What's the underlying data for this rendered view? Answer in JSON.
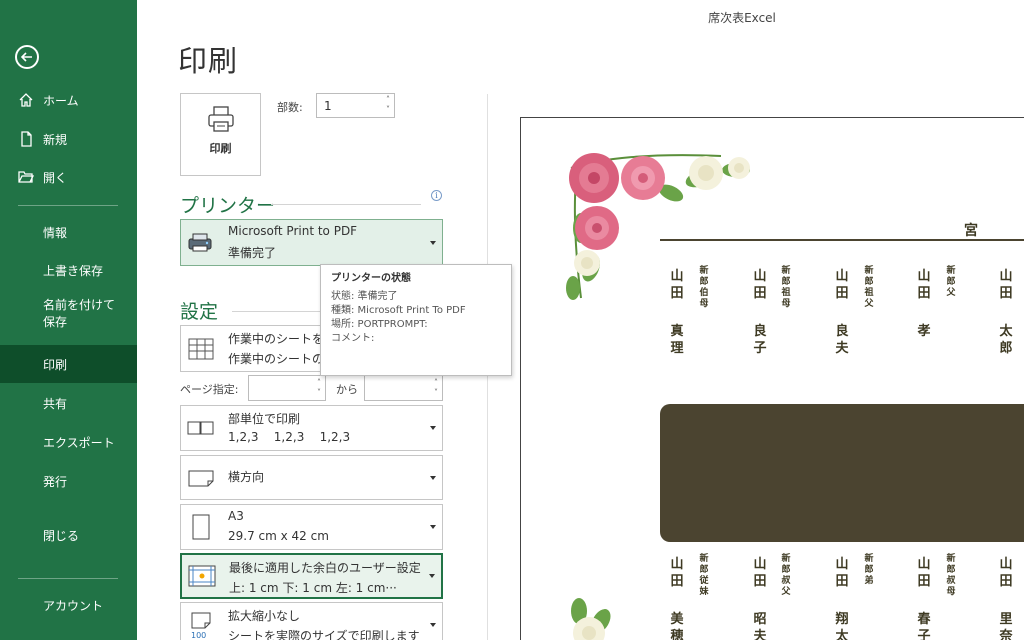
{
  "app": {
    "window_title": "席次表Excel"
  },
  "sidebar": {
    "items": [
      {
        "label": "ホーム"
      },
      {
        "label": "新規"
      },
      {
        "label": "開く"
      },
      {
        "label": "情報"
      },
      {
        "label": "上書き保存"
      },
      {
        "label": "名前を付けて保存"
      },
      {
        "label": "印刷"
      },
      {
        "label": "共有"
      },
      {
        "label": "エクスポート"
      },
      {
        "label": "発行"
      },
      {
        "label": "閉じる"
      },
      {
        "label": "アカウント"
      }
    ],
    "active": "印刷"
  },
  "page": {
    "title": "印刷"
  },
  "print": {
    "button_label": "印刷",
    "copies_label": "部数:",
    "copies_value": "1"
  },
  "printer": {
    "section_title": "プリンター",
    "name": "Microsoft Print to PDF",
    "status": "準備完了"
  },
  "tooltip": {
    "title": "プリンターの状態",
    "lines": [
      "状態: 準備完了",
      "種類: Microsoft Print To PDF",
      "場所: PORTPROMPT:",
      "コメント:"
    ]
  },
  "settings": {
    "section_title": "設定",
    "scope": {
      "line1": "作業中のシートを",
      "line2": "作業中のシートの"
    },
    "pages_label": "ページ指定:",
    "to_label": "から",
    "collate": {
      "line1": "部単位で印刷",
      "line2": "1,2,3    1,2,3    1,2,3"
    },
    "orientation": {
      "line1": "横方向"
    },
    "paper": {
      "line1": "A3",
      "line2": "29.7 cm x 42 cm"
    },
    "margins": {
      "line1": "最後に適用した余白のユーザー設定",
      "line2": "上: 1 cm 下: 1 cm 左: 1 cm···"
    },
    "scaling": {
      "line1": "拡大縮小なし",
      "line2": "シートを実際のサイズで印刷します",
      "icon_text": "100"
    }
  },
  "preview": {
    "header_char": "宮",
    "top_guests": [
      {
        "role": "新郎伯母",
        "surname": "山田",
        "given": "真理"
      },
      {
        "role": "新郎祖母",
        "surname": "山田",
        "given": "良子"
      },
      {
        "role": "新郎祖父",
        "surname": "山田",
        "given": "良夫"
      },
      {
        "role": "新郎父",
        "surname": "山田",
        "given": "孝"
      },
      {
        "role": "",
        "surname": "山田",
        "given": "太郎"
      }
    ],
    "bottom_guests": [
      {
        "role": "新郎従妹",
        "surname": "山田",
        "given": "美穂"
      },
      {
        "role": "新郎叔父",
        "surname": "山田",
        "given": "昭夫"
      },
      {
        "role": "新郎弟",
        "surname": "山田",
        "given": "翔太"
      },
      {
        "role": "新郎叔母",
        "surname": "山田",
        "given": "春子"
      },
      {
        "role": "",
        "surname": "山田",
        "given": "里奈"
      }
    ]
  }
}
